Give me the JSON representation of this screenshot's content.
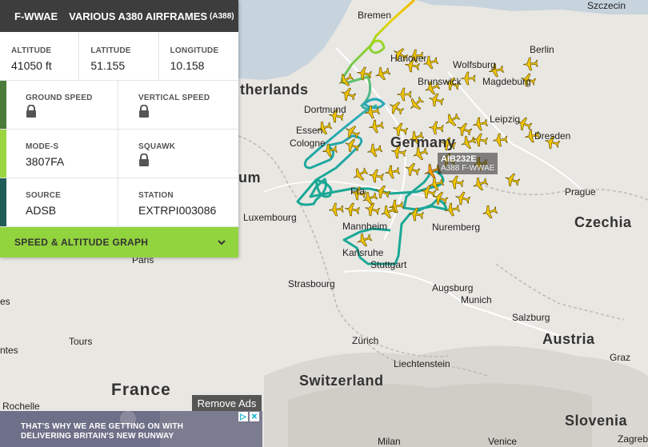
{
  "panel": {
    "registration": "F-WWAE",
    "title": "VARIOUS A380 AIRFRAMES",
    "type_code": "(A388)",
    "altitude": {
      "label": "ALTITUDE",
      "value": "41050 ft"
    },
    "latitude": {
      "label": "LATITUDE",
      "value": "51.155"
    },
    "longitude": {
      "label": "LONGITUDE",
      "value": "10.158"
    },
    "ground_speed": {
      "label": "GROUND SPEED"
    },
    "vertical_speed": {
      "label": "VERTICAL SPEED"
    },
    "mode_s": {
      "label": "MODE-S",
      "value": "3807FA"
    },
    "squawk": {
      "label": "SQUAWK"
    },
    "source": {
      "label": "SOURCE",
      "value": "ADSB"
    },
    "station": {
      "label": "STATION",
      "value": "EXTRPI003086"
    },
    "graph_label": "SPEED & ALTITUDE GRAPH",
    "stripe_colors": [
      "#4b7a3a",
      "#9bd640",
      "#1f5b57"
    ]
  },
  "flight_tag": {
    "callsign": "AIB232E",
    "detail": "A388  F-WWAE"
  },
  "ads": {
    "remove_label": "Remove Ads",
    "banner_line1": "THAT'S WHY WE ARE GETTING ON WITH",
    "banner_line2": "DELIVERING BRITAIN'S NEW RUNWAY"
  },
  "map_labels": {
    "szczecin": "Szczecin",
    "bremen": "Bremen",
    "berlin": "Berlin",
    "hanover": "Hanover",
    "wolfsburg": "Wolfsburg",
    "brunswick": "Brunswick",
    "magdeburg": "Magdeburg",
    "netherlands": "therlands",
    "dortmund": "Dortmund",
    "essen": "Essen",
    "cologne": "Cologne",
    "leipzig": "Leipzig",
    "dresden": "Dresden",
    "germany": "Germany",
    "belgium": "um",
    "frankfurt": "Fra",
    "luxembourg": "Luxembourg",
    "prague": "Prague",
    "czechia": "Czechia",
    "mannheim": "Mannheim",
    "nuremberg": "Nuremberg",
    "karlsruhe": "Karlsruhe",
    "stuttgart": "Stuttgart",
    "paris": "Paris",
    "strasbourg": "Strasbourg",
    "augsburg": "Augsburg",
    "munich": "Munich",
    "salzburg": "Salzburg",
    "les": "es",
    "austria": "Austria",
    "tours": "Tours",
    "zurich": "Zürich",
    "graz": "Graz",
    "ntes": "ntes",
    "liechtenstein": "Liechtenstein",
    "switzerland": "Switzerland",
    "france": "France",
    "rochelle": "Rochelle",
    "slovenia": "Slovenia",
    "milan": "Milan",
    "venice": "Venice",
    "zagreb": "Zagreb"
  },
  "colors": {
    "accent": "#92d43e",
    "header": "#3d3d3d",
    "trail_teal": "#1ba896",
    "plane": "#f2c500"
  }
}
